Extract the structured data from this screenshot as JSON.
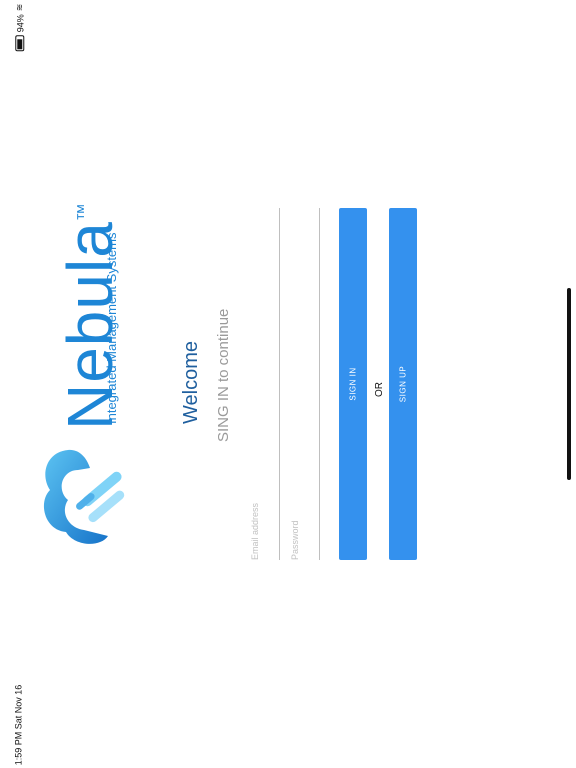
{
  "status_bar": {
    "time_date": "1:59 PM  Sat Nov 16",
    "battery_percent": "94%"
  },
  "brand": {
    "name": "Nebula",
    "trademark": "™",
    "tagline": "Integrated Management Systems"
  },
  "login": {
    "welcome": "Welcome",
    "subtitle": "SING IN to continue",
    "email_placeholder": "Email address",
    "password_placeholder": "Password",
    "sign_in_label": "SIGN IN",
    "or_label": "OR",
    "sign_up_label": "SIGN UP"
  },
  "colors": {
    "brand_blue": "#1e86d6",
    "button_blue": "#3491ee",
    "heading_blue": "#1f5f9e"
  },
  "icons": [
    "wifi-icon",
    "battery-icon",
    "cloud-logo-icon"
  ]
}
